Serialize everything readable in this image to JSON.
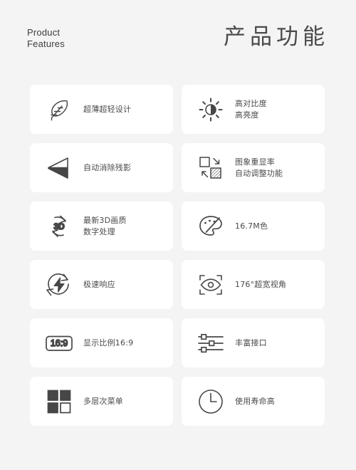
{
  "header": {
    "eyebrow": "Product\nFeatures",
    "title_cn": "产品功能"
  },
  "theme": {
    "background": "#f4f4f4",
    "card_background": "#ffffff",
    "icon_color": "#474747",
    "text_color": "#4a4a4a"
  },
  "features": [
    {
      "icon": "feather-icon",
      "label": "超薄超轻设计"
    },
    {
      "icon": "brightness-sun-icon",
      "label": "高对比度\n高亮度"
    },
    {
      "icon": "ghosting-triangle-icon",
      "label": "自动消除残影"
    },
    {
      "icon": "image-resize-icon",
      "label": "图象重显率\n自动调整功能"
    },
    {
      "icon": "3d-rotate-icon",
      "label": "最新3D画质\n数字处理"
    },
    {
      "icon": "palette-icon",
      "label": "16.7M色"
    },
    {
      "icon": "lightning-refresh-icon",
      "label": "极速响应"
    },
    {
      "icon": "eye-focus-icon",
      "label": "176°超宽视角"
    },
    {
      "icon": "aspect-ratio-icon",
      "label": "显示比例16:9"
    },
    {
      "icon": "sliders-icon",
      "label": "丰富接口"
    },
    {
      "icon": "grid-squares-icon",
      "label": "多层次菜单"
    },
    {
      "icon": "clock-icon",
      "label": "使用寿命高"
    }
  ],
  "icon_labels": {
    "3d_text": "3D",
    "aspect_ratio_text": "16:9"
  }
}
